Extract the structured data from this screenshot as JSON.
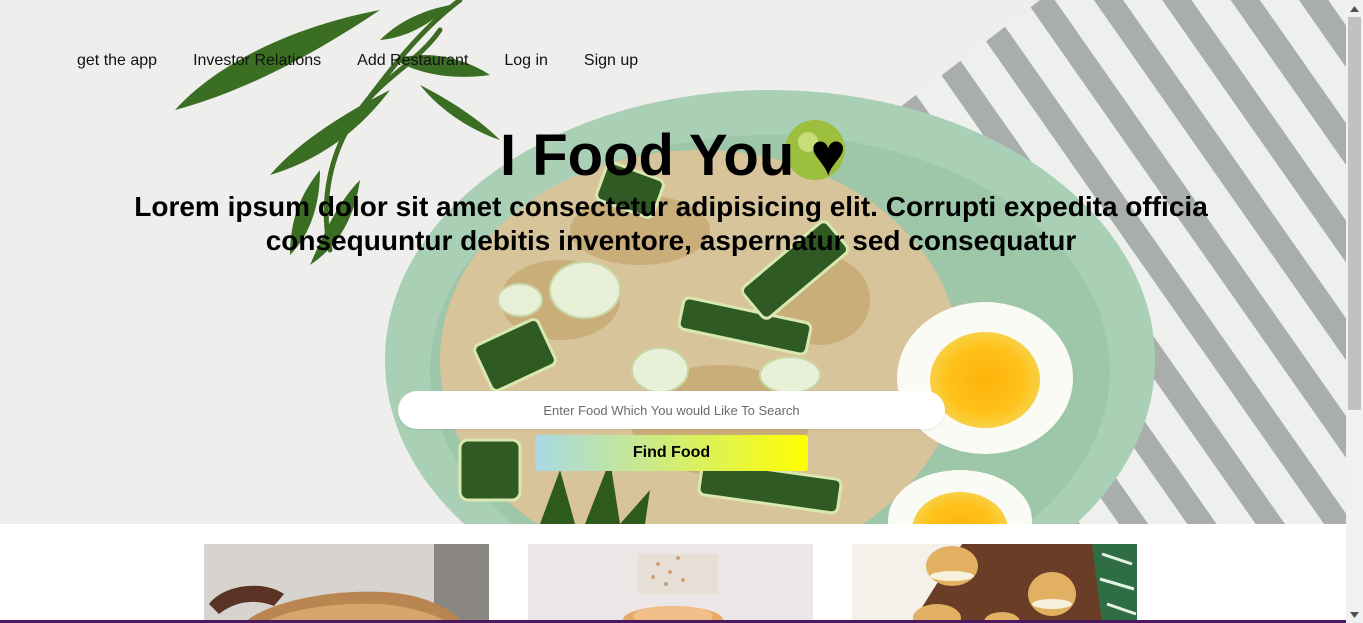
{
  "nav": {
    "items": [
      {
        "label": "get the app"
      },
      {
        "label": "Investor Relations"
      },
      {
        "label": "Add Restaurant"
      },
      {
        "label": "Log in"
      },
      {
        "label": "Sign up"
      }
    ]
  },
  "hero": {
    "title": "I Food You",
    "title_icon": "heart-icon",
    "subtitle": "Lorem ipsum dolor sit amet consectetur adipisicing elit. Corrupti expedita officia consequuntur debitis inventore, aspernatur sed consequatur"
  },
  "search": {
    "placeholder": "Enter Food Which You would Like To Search",
    "value": "",
    "button_label": "Find Food"
  },
  "cards": [
    {
      "image": "bread-photo"
    },
    {
      "image": "flour-photo"
    },
    {
      "image": "cream-puffs-photo"
    }
  ],
  "colors": {
    "button_gradient_start": "#a8d8e6",
    "button_gradient_end": "#ffff00",
    "plate": "#a9cfb4",
    "bottom_line": "#4a1a5c"
  }
}
